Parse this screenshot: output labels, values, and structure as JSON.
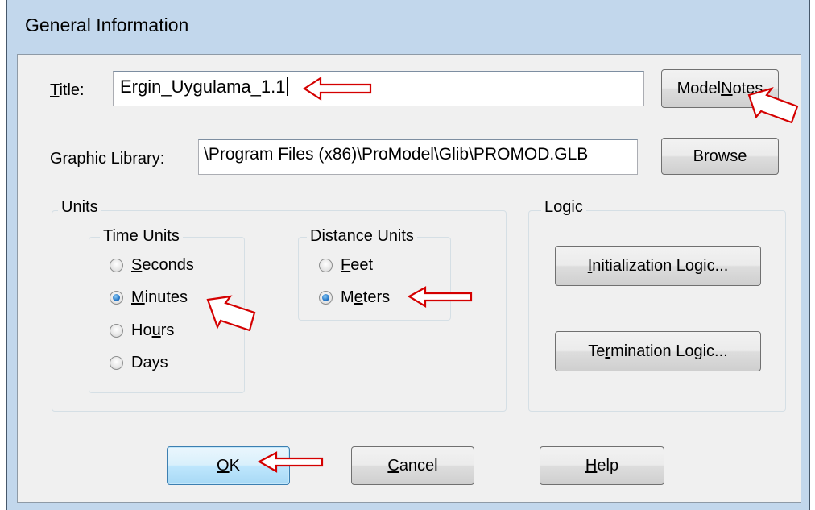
{
  "dialog": {
    "title": "General Information"
  },
  "title_field": {
    "label_mnemonic": "T",
    "label_rest": "itle:",
    "value": "Ergin_Uygulama_1.1"
  },
  "model_notes_button": {
    "pre": "Model ",
    "mnemonic": "N",
    "post": "otes"
  },
  "graphic_library": {
    "label": "Graphic Library:",
    "value": "\\Program Files (x86)\\ProModel\\Glib\\PROMOD.GLB",
    "browse_label": "Browse"
  },
  "units": {
    "group_label": "Units",
    "time_units": {
      "group_label": "Time Units",
      "options": [
        {
          "mnemonic": "S",
          "rest": "econds",
          "checked": false
        },
        {
          "mnemonic": "M",
          "rest": "inutes",
          "checked": true
        },
        {
          "pre": "Ho",
          "mnemonic": "u",
          "rest": "rs",
          "checked": false
        },
        {
          "mnemonic": "",
          "rest": "Days",
          "checked": false
        }
      ]
    },
    "distance_units": {
      "group_label": "Distance Units",
      "options": [
        {
          "mnemonic": "F",
          "rest": "eet",
          "checked": false
        },
        {
          "pre": "M",
          "mnemonic": "e",
          "rest": "ters",
          "checked": true
        }
      ]
    }
  },
  "logic": {
    "group_label": "Logic",
    "initialization": {
      "mnemonic": "I",
      "rest": "nitialization Logic..."
    },
    "termination": {
      "pre": "Te",
      "mnemonic": "r",
      "rest": "mination Logic..."
    }
  },
  "footer": {
    "ok": {
      "mnemonic": "O",
      "rest": "K"
    },
    "cancel": {
      "mnemonic": "C",
      "rest": "ancel"
    },
    "help": {
      "mnemonic": "H",
      "rest": "elp"
    }
  },
  "annotation_color": "#d40000"
}
